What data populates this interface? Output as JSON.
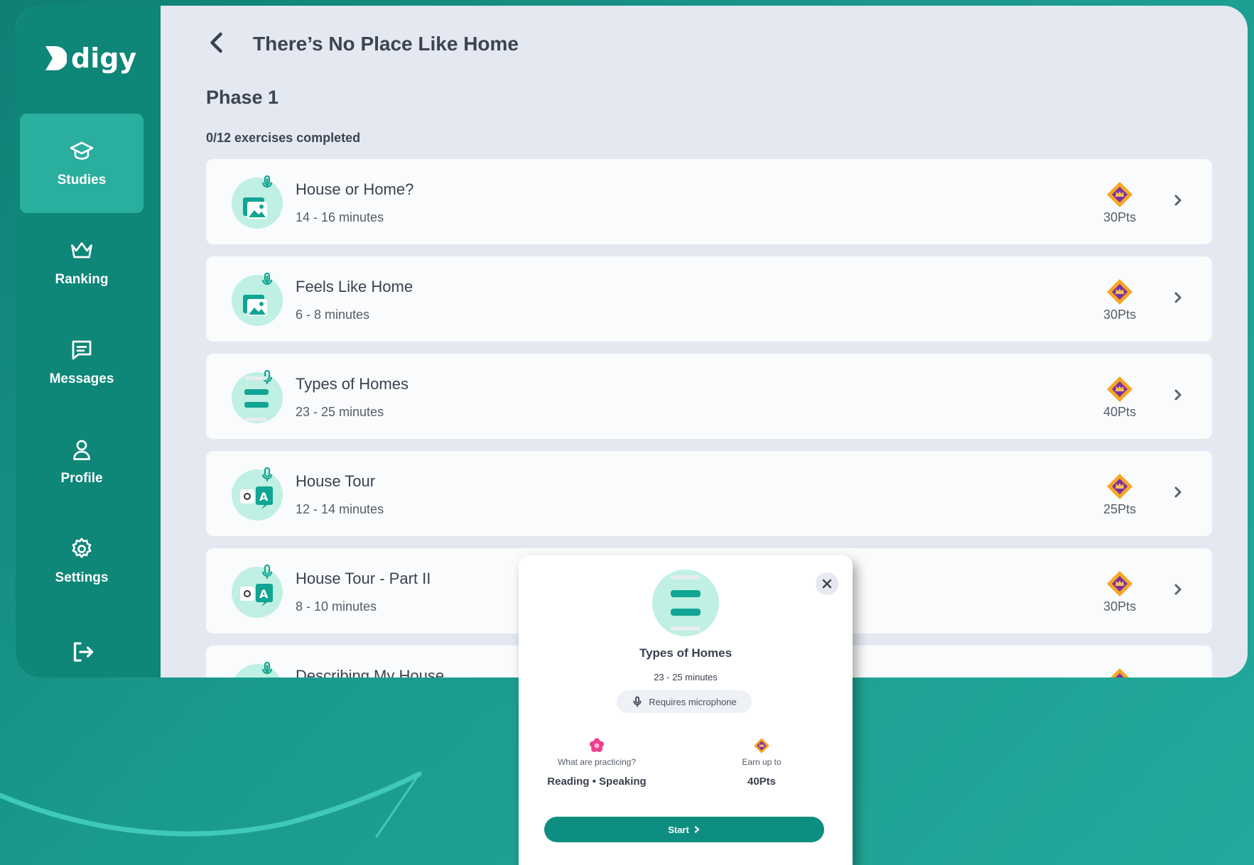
{
  "brand": {
    "name": "digy"
  },
  "sidebar": {
    "items": [
      {
        "label": "Studies",
        "icon": "graduation-cap-icon",
        "active": true
      },
      {
        "label": "Ranking",
        "icon": "crown-icon",
        "active": false
      },
      {
        "label": "Messages",
        "icon": "message-icon",
        "active": false
      },
      {
        "label": "Profile",
        "icon": "user-icon",
        "active": false
      },
      {
        "label": "Settings",
        "icon": "gear-icon",
        "active": false
      }
    ],
    "logout_icon": "logout-icon"
  },
  "header": {
    "title": "There’s No Place Like Home"
  },
  "phase": {
    "title": "Phase 1",
    "progress": "0/12 exercises completed"
  },
  "exercises": [
    {
      "title": "House or Home?",
      "duration": "14 - 16 minutes",
      "points": "30Pts",
      "icon": "image-mic-icon"
    },
    {
      "title": "Feels Like Home",
      "duration": "6 - 8 minutes",
      "points": "30Pts",
      "icon": "image-mic-icon"
    },
    {
      "title": "Types of Homes",
      "duration": "23 - 25 minutes",
      "points": "40Pts",
      "icon": "text-lines-mic-icon"
    },
    {
      "title": "House Tour",
      "duration": "12 - 14 minutes",
      "points": "25Pts",
      "icon": "translate-mic-icon"
    },
    {
      "title": "House Tour - Part II",
      "duration": "8 - 10 minutes",
      "points": "30Pts",
      "icon": "translate-mic-icon"
    },
    {
      "title": "Describing My House",
      "duration": "",
      "points": "",
      "icon": "image-mic-icon"
    }
  ],
  "popup": {
    "title": "Types of Homes",
    "duration": "23 - 25 minutes",
    "requirement": "Requires microphone",
    "practicing_label": "What are practicing?",
    "practicing_value": "Reading • Speaking",
    "earn_label": "Earn up to",
    "earn_value": "40Pts",
    "start_label": "Start"
  },
  "colors": {
    "background": "#1a9a8d",
    "sidebar": "#0e8678",
    "sidebar_active": "#2aae9e",
    "content_bg": "#e3e8f1",
    "accent": "#0e8e80",
    "gem_orange": "#f5a623",
    "gem_purple": "#7b2fa6"
  }
}
